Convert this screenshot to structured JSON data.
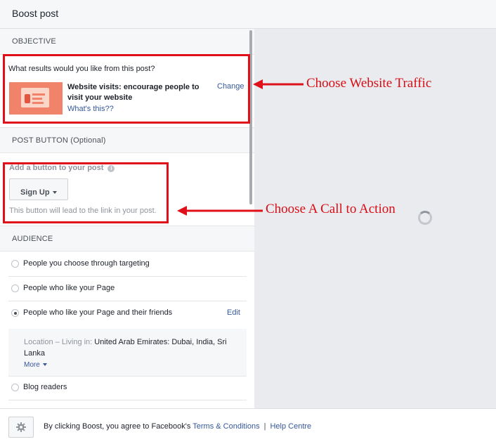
{
  "header": {
    "title": "Boost post"
  },
  "objective": {
    "section_label": "OBJECTIVE",
    "question": "What results would you like from this post?",
    "title": "Website visits: encourage people to visit your website",
    "whats_this": "What's this??",
    "change": "Change"
  },
  "post_button": {
    "section_label": "POST BUTTON (Optional)",
    "add_label": "Add a button to your post",
    "info_glyph": "i",
    "selected_button": "Sign Up",
    "hint": "This button will lead to the link in your post."
  },
  "audience": {
    "section_label": "AUDIENCE",
    "options": [
      {
        "label": "People you choose through targeting",
        "checked": false
      },
      {
        "label": "People who like your Page",
        "checked": false
      },
      {
        "label": "People who like your Page and their friends",
        "checked": true
      },
      {
        "label": "Blog readers",
        "checked": false
      }
    ],
    "edit": "Edit",
    "location_prefix": "Location – Living in:",
    "location_value": "United Arab Emirates: Dubai, India, Sri Lanka",
    "more": "More"
  },
  "footer": {
    "text": "By clicking Boost, you agree to Facebook's",
    "terms": "Terms & Conditions",
    "separator": "|",
    "help": "Help Centre"
  },
  "annotations": {
    "objective_note": "Choose Website Traffic",
    "button_note": "Choose A Call to Action",
    "color": "#e0101a"
  }
}
